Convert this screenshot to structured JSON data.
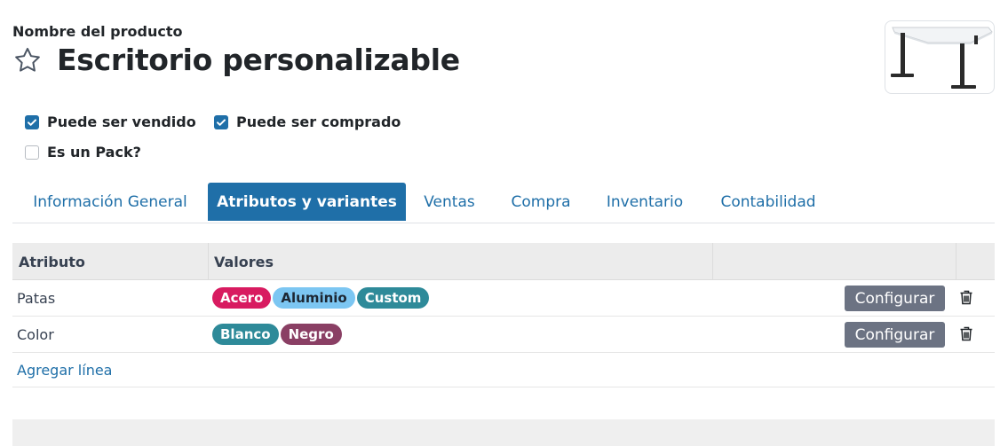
{
  "product": {
    "field_label": "Nombre del producto",
    "name": "Escritorio personalizable",
    "favorite_icon": "star-outline-icon",
    "image_alt": "desk-image"
  },
  "checkboxes": [
    {
      "label": "Puede ser vendido",
      "checked": true
    },
    {
      "label": "Puede ser comprado",
      "checked": true
    },
    {
      "label": "Es un Pack?",
      "checked": false
    }
  ],
  "tabs": [
    {
      "label": "Información General",
      "active": false
    },
    {
      "label": "Atributos y variantes",
      "active": true
    },
    {
      "label": "Ventas",
      "active": false
    },
    {
      "label": "Compra",
      "active": false
    },
    {
      "label": "Inventario",
      "active": false
    },
    {
      "label": "Contabilidad",
      "active": false
    }
  ],
  "table": {
    "headers": [
      "Atributo",
      "Valores"
    ],
    "rows": [
      {
        "attribute": "Patas",
        "values": [
          {
            "label": "Acero",
            "bg": "#d81b60",
            "fg": "#ffffff"
          },
          {
            "label": "Aluminio",
            "bg": "#7cc6f2",
            "fg": "#1d2733"
          },
          {
            "label": "Custom",
            "bg": "#2e8a99",
            "fg": "#ffffff"
          }
        ],
        "button": "Configurar"
      },
      {
        "attribute": "Color",
        "values": [
          {
            "label": "Blanco",
            "bg": "#2e8a99",
            "fg": "#ffffff"
          },
          {
            "label": "Negro",
            "bg": "#8a3f64",
            "fg": "#ffffff"
          }
        ],
        "button": "Configurar"
      }
    ],
    "add_line": "Agregar línea"
  },
  "colors": {
    "accent": "#1f6fa8",
    "button_gray": "#6c7383"
  }
}
